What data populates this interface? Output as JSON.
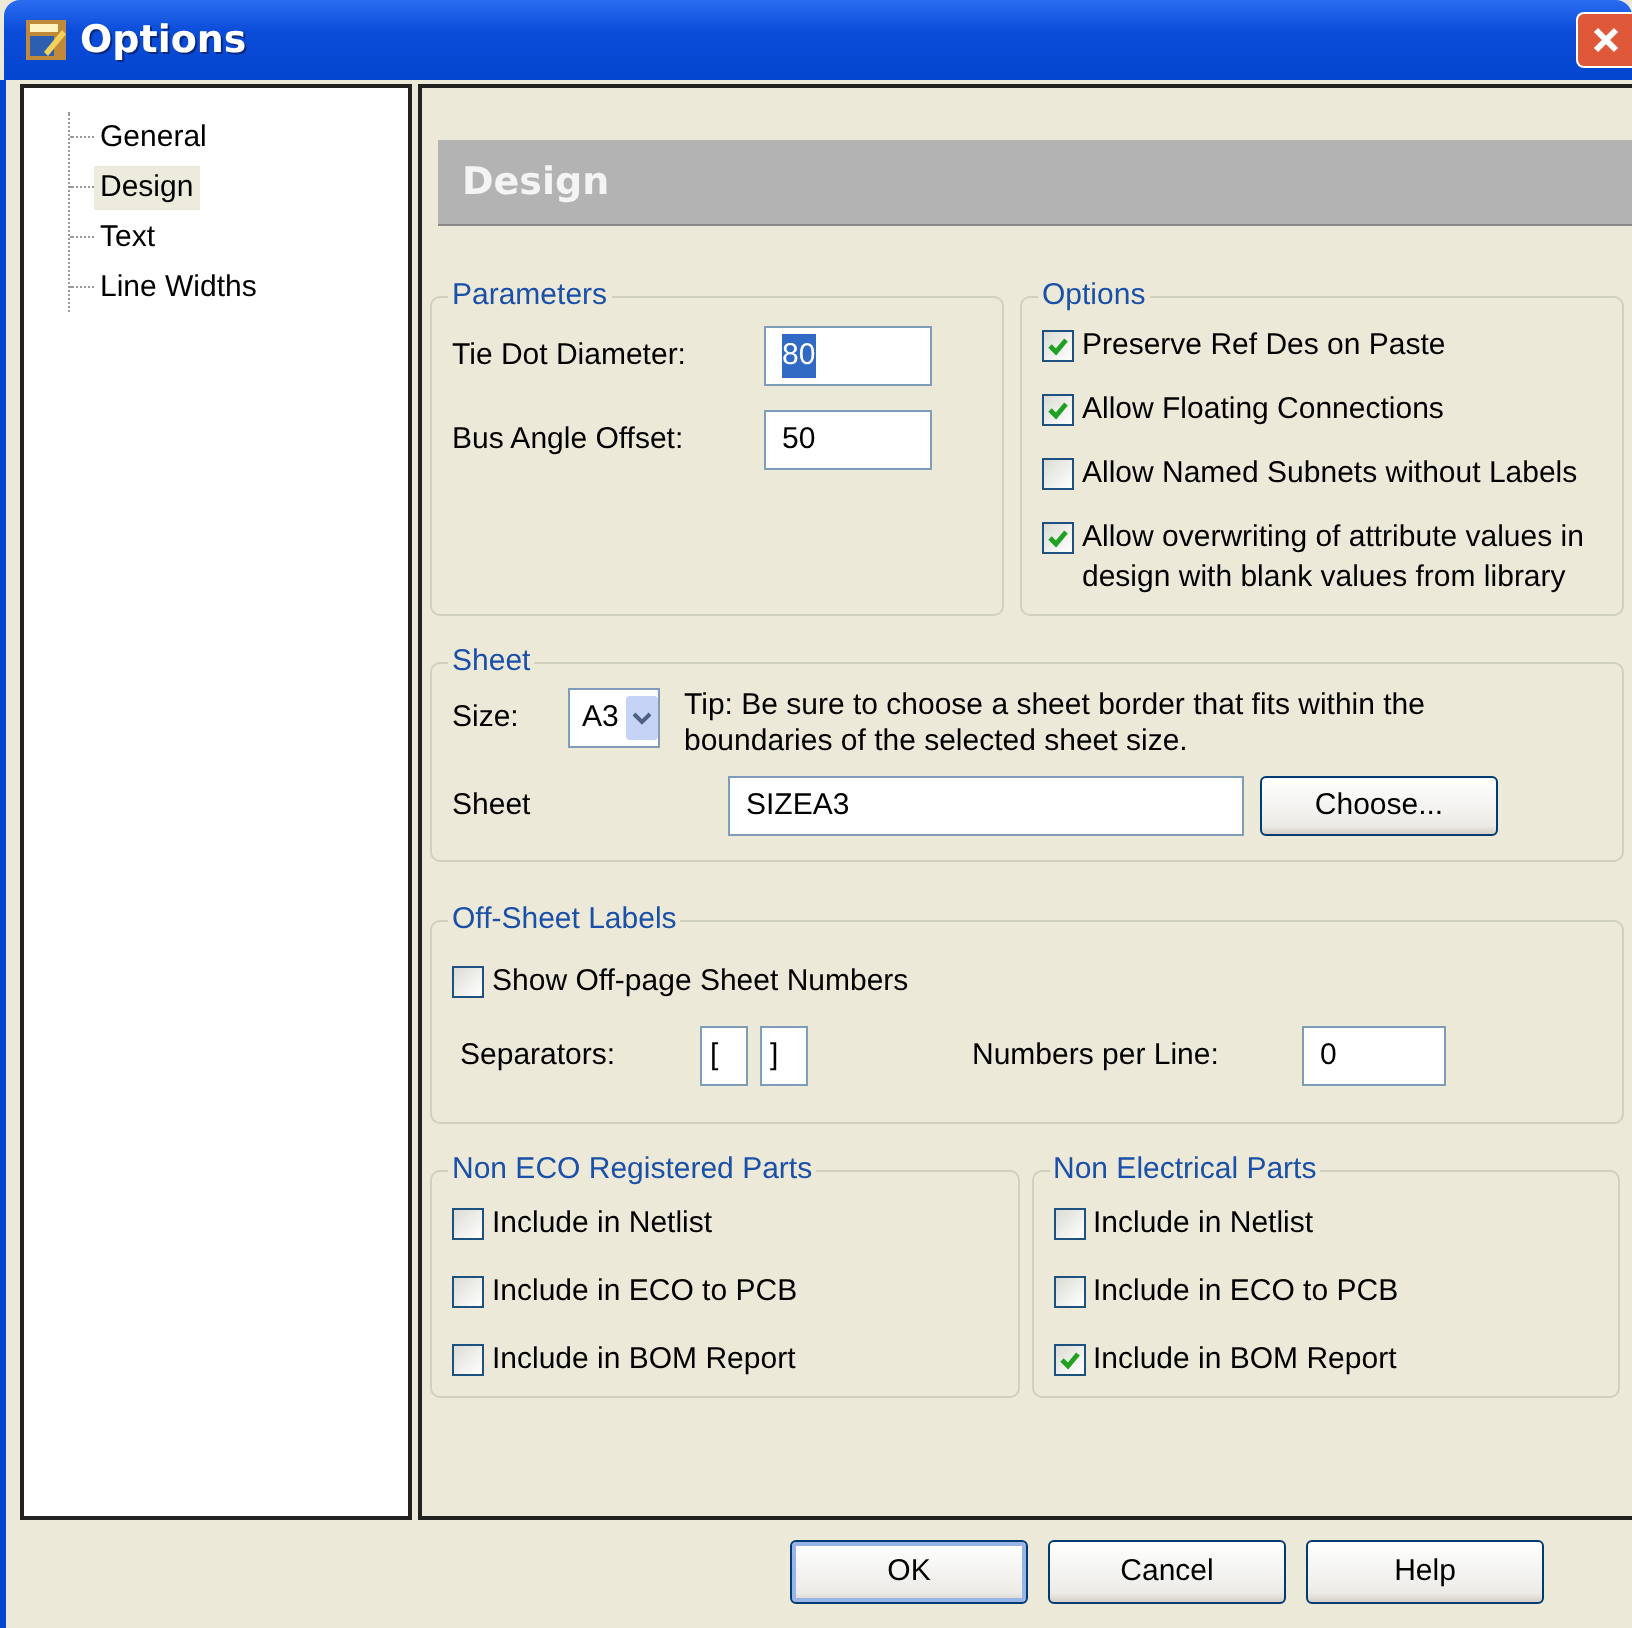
{
  "window": {
    "title": "Options"
  },
  "tree": [
    {
      "label": "General",
      "selected": false
    },
    {
      "label": "Design",
      "selected": true
    },
    {
      "label": "Text",
      "selected": false
    },
    {
      "label": "Line Widths",
      "selected": false
    }
  ],
  "header": "Design",
  "parameters": {
    "title": "Parameters",
    "fields": [
      {
        "label": "Tie Dot Diameter:",
        "value": "80",
        "text_selected": true
      },
      {
        "label": "Bus Angle Offset:",
        "value": "50",
        "text_selected": false
      }
    ]
  },
  "options": {
    "title": "Options",
    "checkboxes": [
      {
        "label": "Preserve Ref Des on Paste",
        "checked": true
      },
      {
        "label": "Allow Floating Connections",
        "checked": true
      },
      {
        "label": "Allow Named Subnets without Labels",
        "checked": false
      },
      {
        "label": "Allow overwriting of attribute values in design with blank values from library",
        "checked": true
      }
    ]
  },
  "sheet": {
    "title": "Sheet",
    "size_label": "Size:",
    "size_value": "A3",
    "tip": "Tip: Be sure to choose a sheet border that fits within the boundaries of the selected sheet size.",
    "sheet_label": "Sheet",
    "sheet_value": "SIZEA3",
    "choose_button": "Choose..."
  },
  "off_sheet": {
    "title": "Off-Sheet Labels",
    "checkbox": {
      "label": "Show Off-page Sheet Numbers",
      "checked": false
    },
    "separators_label": "Separators:",
    "separators": [
      "[",
      "]"
    ],
    "numbers_label": "Numbers per Line:",
    "numbers_value": "0"
  },
  "part_groups": [
    {
      "title": "Non ECO Registered Parts",
      "checkboxes": [
        {
          "label": "Include in Netlist",
          "checked": false
        },
        {
          "label": "Include in ECO to PCB",
          "checked": false
        },
        {
          "label": "Include in BOM Report",
          "checked": false
        }
      ]
    },
    {
      "title": "Non Electrical Parts",
      "checkboxes": [
        {
          "label": "Include in Netlist",
          "checked": false
        },
        {
          "label": "Include in ECO to PCB",
          "checked": false
        },
        {
          "label": "Include in BOM Report",
          "checked": true
        }
      ]
    }
  ],
  "buttons": [
    {
      "label": "OK",
      "default": true
    },
    {
      "label": "Cancel",
      "default": false
    },
    {
      "label": "Help",
      "default": false
    }
  ]
}
